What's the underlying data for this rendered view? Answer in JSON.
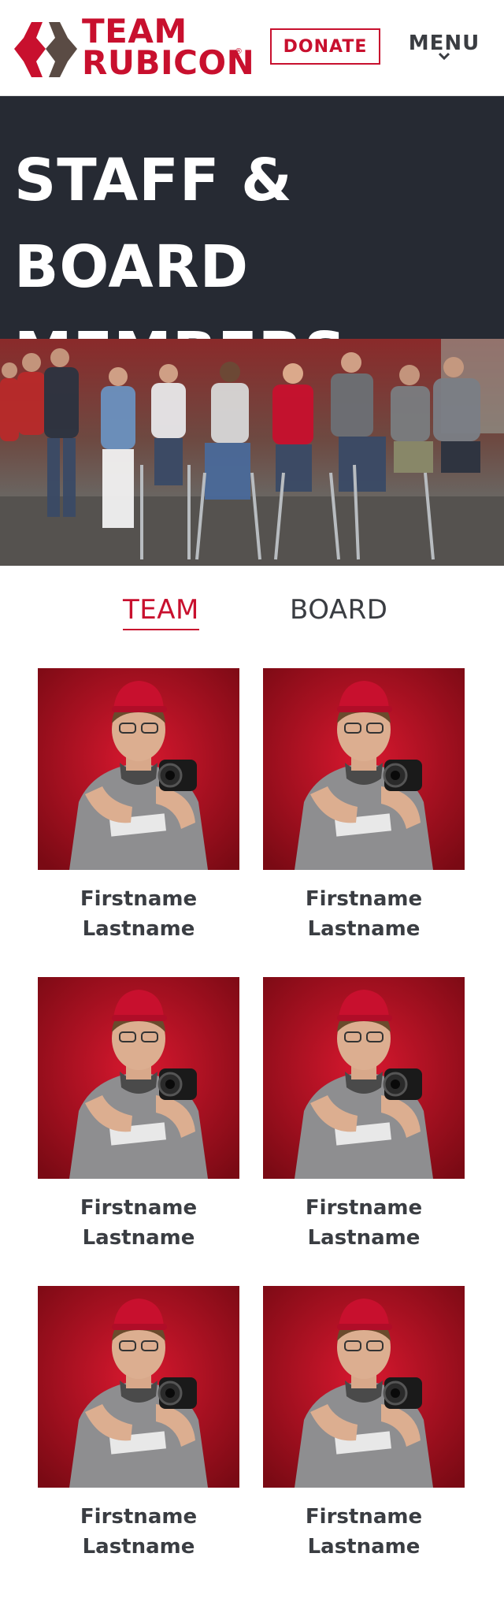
{
  "header": {
    "logo": {
      "line1": "TEAM",
      "line2": "RUBICON",
      "reg": "®",
      "mark_icon": "rubicon-logo-mark-icon"
    },
    "donate_label": "DONATE",
    "menu_label": "MENU",
    "menu_icon": "chevron-down-icon"
  },
  "hero": {
    "title": "STAFF & BOARD MEMBERS"
  },
  "tabs": {
    "team_label": "TEAM",
    "board_label": "BOARD",
    "active": "team"
  },
  "members": [
    {
      "first": "Firstname",
      "last": "Lastname"
    },
    {
      "first": "Firstname",
      "last": "Lastname"
    },
    {
      "first": "Firstname",
      "last": "Lastname"
    },
    {
      "first": "Firstname",
      "last": "Lastname"
    },
    {
      "first": "Firstname",
      "last": "Lastname"
    },
    {
      "first": "Firstname",
      "last": "Lastname"
    }
  ],
  "colors": {
    "brand_red": "#c8102e",
    "hero_bg": "#262a33",
    "text_dark": "#3a3d42"
  }
}
